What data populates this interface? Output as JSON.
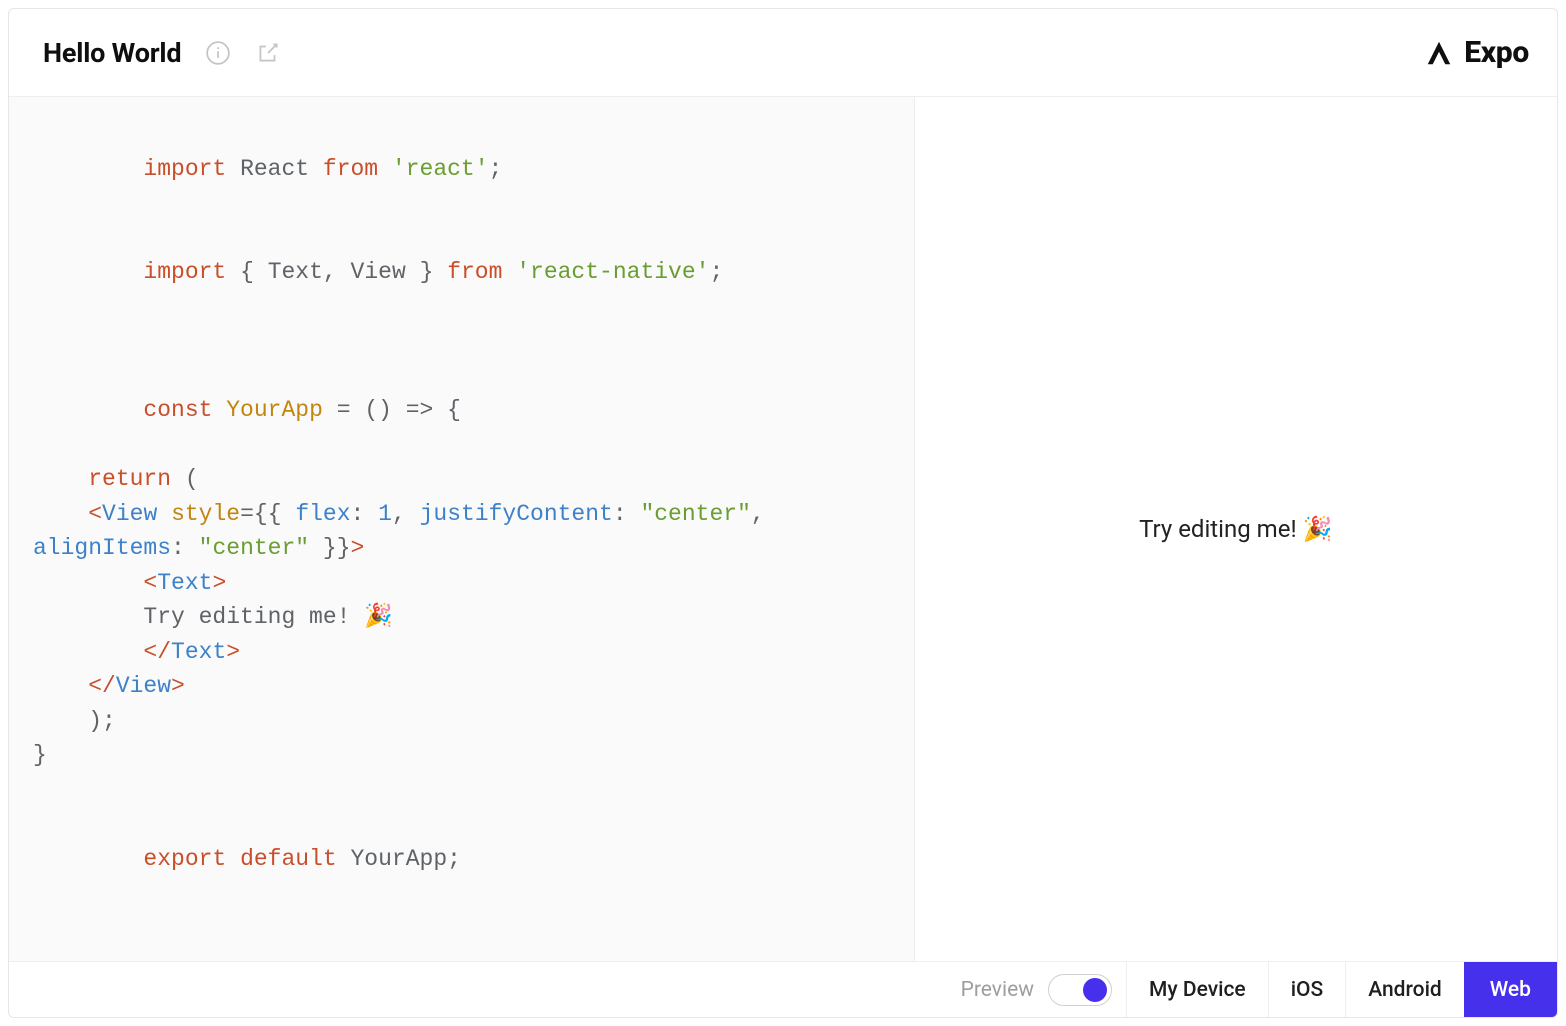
{
  "header": {
    "title": "Hello World",
    "brand": "Expo"
  },
  "code": {
    "line1": {
      "import": "import",
      "react": "React",
      "from": "from",
      "reactStr": "'react'",
      "semi": ";"
    },
    "line2": {
      "import": "import",
      "lbrace": "{",
      "text": "Text",
      "comma": ",",
      "view": "View",
      "rbrace": "}",
      "from": "from",
      "nativeStr": "'react-native'",
      "semi": ";"
    },
    "line4": {
      "const": "const",
      "yourApp": "YourApp",
      "eq": "=",
      "parens": "()",
      "arrow": "=>",
      "lbrace": "{"
    },
    "line5": {
      "indent": "    ",
      "return": "return",
      "lparen": "("
    },
    "line6": {
      "indent": "    ",
      "lt": "<",
      "view": "View",
      "style": "style",
      "eq": "=",
      "lbraces": "{{",
      "flexKey": "flex",
      "colon1": ":",
      "flexVal": "1",
      "comma1": ",",
      "justifyKey": "justifyContent",
      "colon2": ":",
      "justifyVal": "\"center\"",
      "comma2": ","
    },
    "line7": {
      "alignKey": "alignItems",
      "colon": ":",
      "alignVal": "\"center\"",
      "rbraces": "}}",
      "gt": ">"
    },
    "line8": {
      "indent": "        ",
      "lt": "<",
      "text": "Text",
      "gt": ">"
    },
    "line9": {
      "indent": "        ",
      "content": "Try editing me! 🎉"
    },
    "line10": {
      "indent": "        ",
      "lt": "</",
      "text": "Text",
      "gt": ">"
    },
    "line11": {
      "indent": "    ",
      "lt": "</",
      "view": "View",
      "gt": ">"
    },
    "line12": {
      "indent": "    ",
      "rparen": ");"
    },
    "line13": {
      "rbrace": "}"
    },
    "line15": {
      "export": "export",
      "default": "default",
      "yourApp": "YourApp",
      "semi": ";"
    }
  },
  "preview": {
    "text": "Try editing me! 🎉"
  },
  "footer": {
    "previewLabel": "Preview",
    "tabs": {
      "myDevice": "My Device",
      "ios": "iOS",
      "android": "Android",
      "web": "Web"
    }
  }
}
